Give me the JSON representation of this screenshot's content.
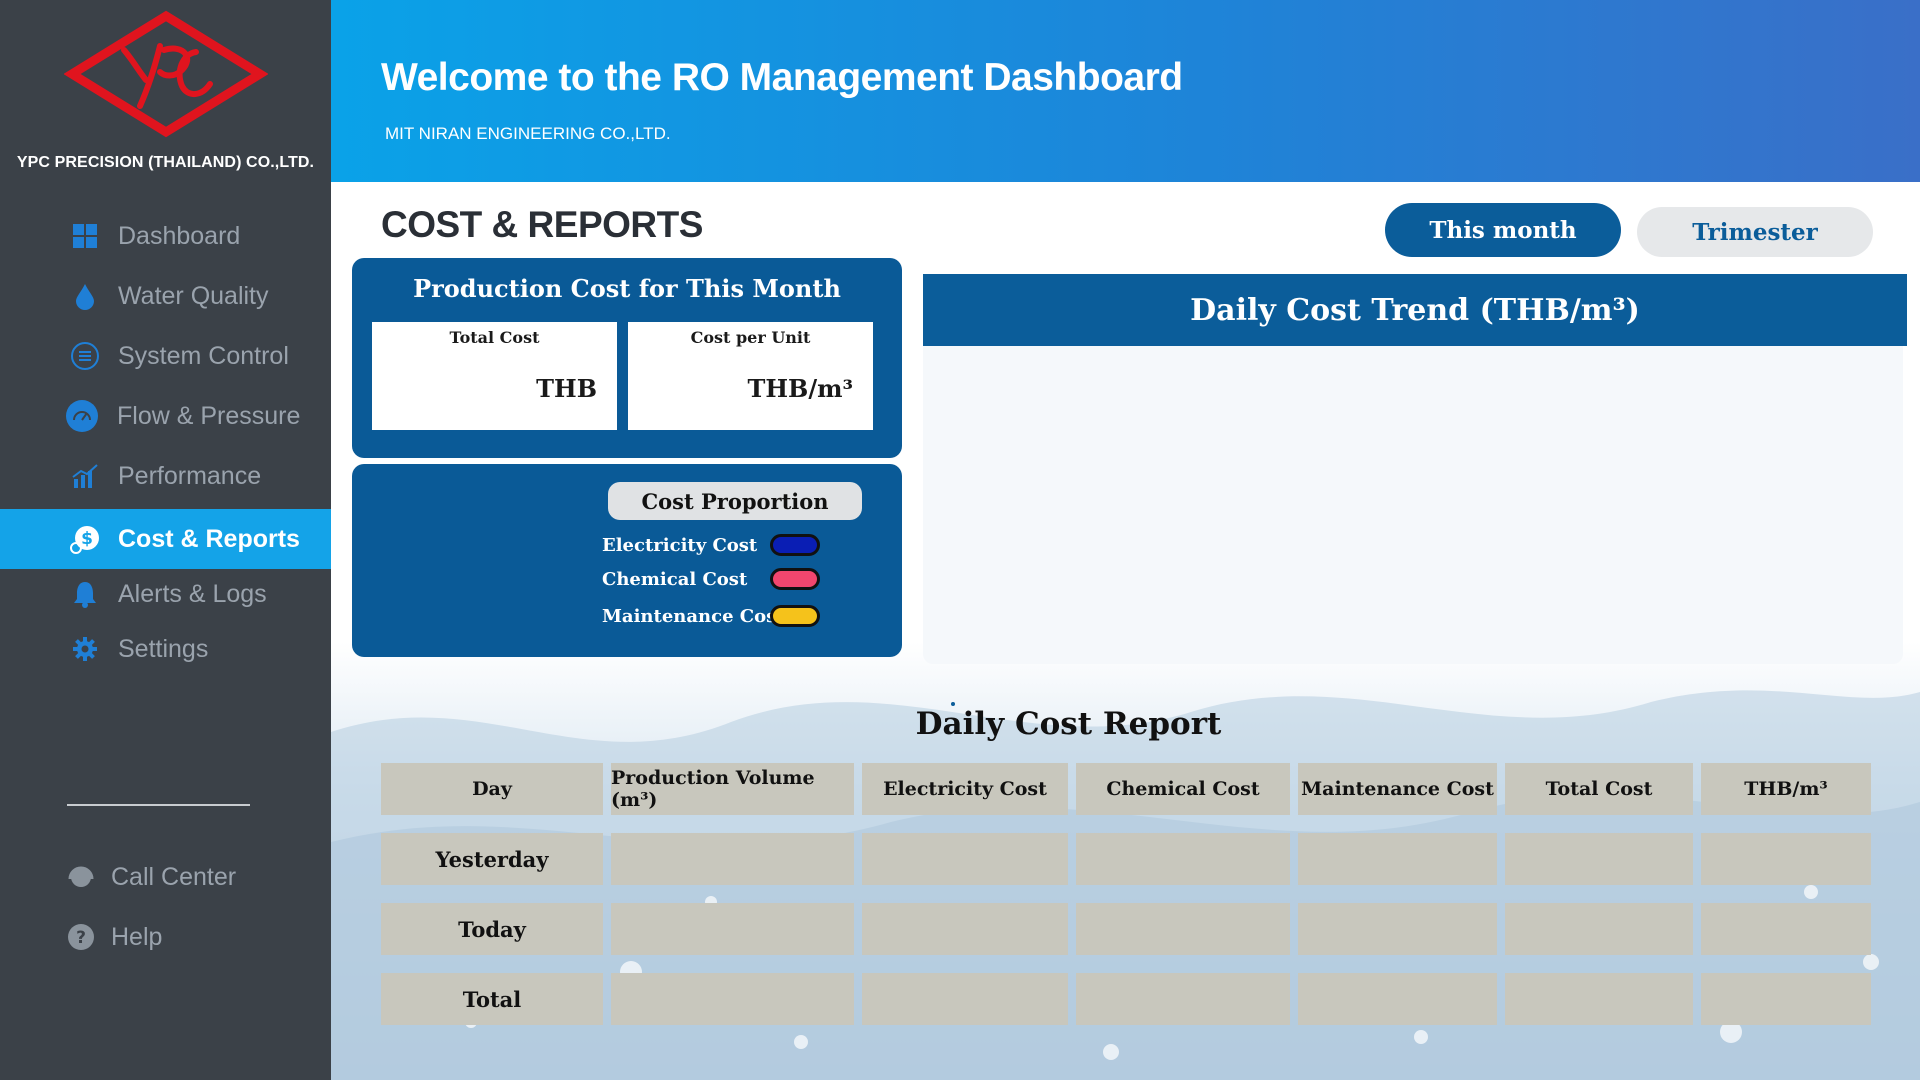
{
  "sidebar": {
    "company_name": "YPC PRECISION (THAILAND) CO.,LTD.",
    "logo_icon": "ypc-logo",
    "items": [
      {
        "label": "Dashboard",
        "icon": "grid-icon"
      },
      {
        "label": "Water Quality",
        "icon": "water-drop-icon"
      },
      {
        "label": "System Control",
        "icon": "control-list-icon"
      },
      {
        "label": "Flow & Pressure",
        "icon": "gauge-icon"
      },
      {
        "label": "Performance",
        "icon": "chart-icon"
      },
      {
        "label": "Cost & Reports",
        "icon": "money-icon"
      },
      {
        "label": "Alerts & Logs",
        "icon": "bell-icon"
      },
      {
        "label": "Settings",
        "icon": "gear-icon"
      }
    ],
    "active_index": 5,
    "bottom": [
      {
        "label": "Call Center",
        "icon": "headset-icon"
      },
      {
        "label": "Help",
        "icon": "help-icon"
      }
    ]
  },
  "header": {
    "title": "Welcome to the RO Management Dashboard",
    "subtitle": "MIT NIRAN ENGINEERING  CO.,LTD."
  },
  "main": {
    "page_title": "COST & REPORTS",
    "period_buttons": {
      "this_month": "This month",
      "trimester": "Trimester"
    },
    "production_cost": {
      "title": "Production Cost for This Month",
      "total_cost_label": "Total Cost",
      "total_cost_unit": "THB",
      "cost_per_unit_label": "Cost per Unit",
      "cost_per_unit_unit": "THB/m³"
    },
    "cost_proportion": {
      "title": "Cost Proportion",
      "legend": [
        {
          "label": "Electricity Cost",
          "color": "#0a1eb4"
        },
        {
          "label": "Chemical Cost",
          "color": "#f2466e"
        },
        {
          "label": "Maintenance Cost",
          "color": "#f5c21b"
        }
      ]
    },
    "trend_title": "Daily Cost Trend (THB/m³)",
    "report": {
      "title": "Daily Cost Report",
      "columns": [
        "Day",
        "Production Volume (m³)",
        "Electricity Cost",
        "Chemical Cost",
        "Maintenance Cost",
        "Total Cost",
        "THB/m³"
      ],
      "rows": [
        "Yesterday",
        "Today",
        "Total"
      ]
    }
  }
}
